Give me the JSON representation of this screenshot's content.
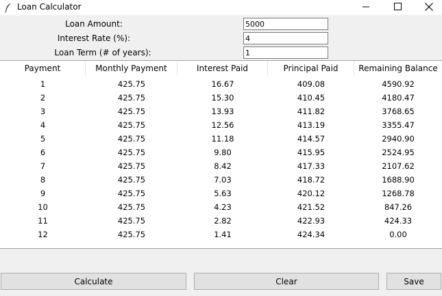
{
  "window": {
    "title": "Loan Calculator"
  },
  "form": {
    "loan_amount_label": "Loan Amount:",
    "loan_amount_value": "5000",
    "interest_rate_label": "Interest Rate (%):",
    "interest_rate_value": "4",
    "loan_term_label": "Loan Term (# of years):",
    "loan_term_value": "1"
  },
  "table": {
    "columns": [
      "Payment",
      "Monthly Payment",
      "Interest Paid",
      "Principal Paid",
      "Remaining Balance"
    ],
    "rows": [
      [
        "1",
        "425.75",
        "16.67",
        "409.08",
        "4590.92"
      ],
      [
        "2",
        "425.75",
        "15.30",
        "410.45",
        "4180.47"
      ],
      [
        "3",
        "425.75",
        "13.93",
        "411.82",
        "3768.65"
      ],
      [
        "4",
        "425.75",
        "12.56",
        "413.19",
        "3355.47"
      ],
      [
        "5",
        "425.75",
        "11.18",
        "414.57",
        "2940.90"
      ],
      [
        "6",
        "425.75",
        "9.80",
        "415.95",
        "2524.95"
      ],
      [
        "7",
        "425.75",
        "8.42",
        "417.33",
        "2107.62"
      ],
      [
        "8",
        "425.75",
        "7.03",
        "418.72",
        "1688.90"
      ],
      [
        "9",
        "425.75",
        "5.63",
        "420.12",
        "1268.78"
      ],
      [
        "10",
        "425.75",
        "4.23",
        "421.52",
        "847.26"
      ],
      [
        "11",
        "425.75",
        "2.82",
        "422.93",
        "424.33"
      ],
      [
        "12",
        "425.75",
        "1.41",
        "424.34",
        "0.00"
      ]
    ]
  },
  "buttons": {
    "calculate": "Calculate",
    "clear": "Clear",
    "save": "Save"
  },
  "icons": {
    "app": "feather-icon",
    "minimize": "minimize-icon",
    "maximize": "maximize-icon",
    "close": "close-icon"
  }
}
